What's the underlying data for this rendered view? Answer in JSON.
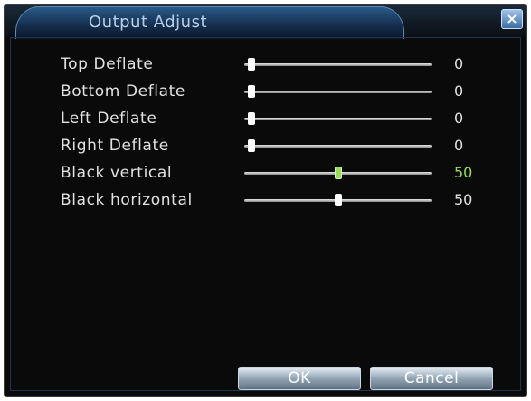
{
  "window": {
    "title": "Output Adjust",
    "close_symbol": "×"
  },
  "sliders": [
    {
      "label": "Top Deflate",
      "value": "0",
      "level": 0,
      "selected": false
    },
    {
      "label": "Bottom Deflate",
      "value": "0",
      "level": 0,
      "selected": false
    },
    {
      "label": "Left Deflate",
      "value": "0",
      "level": 0,
      "selected": false
    },
    {
      "label": "Right Deflate",
      "value": "0",
      "level": 0,
      "selected": false
    },
    {
      "label": "Black vertical",
      "value": "50",
      "level": 0.5,
      "selected": true
    },
    {
      "label": "Black horizontal",
      "value": "50",
      "level": 0.5,
      "selected": false
    }
  ],
  "buttons": {
    "ok_label": "OK",
    "cancel_label": "Cancel"
  },
  "colors": {
    "title_tab": "#1c3f63",
    "selected_accent": "#9bdc58",
    "background": "#0a0a0a",
    "text": "#e2e2e2"
  }
}
